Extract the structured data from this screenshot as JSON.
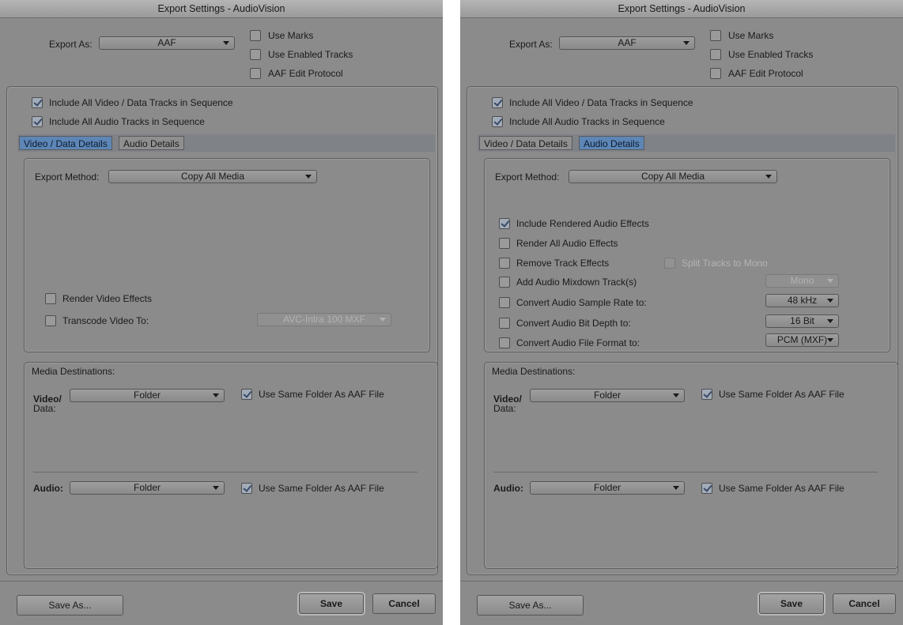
{
  "window_title": "Export Settings - AudioVision",
  "export_as": {
    "label": "Export As:",
    "value": "AAF"
  },
  "options": {
    "use_marks": "Use Marks",
    "use_enabled_tracks": "Use Enabled Tracks",
    "aaf_edit_protocol": "AAF Edit Protocol"
  },
  "include": {
    "video_data": "Include All Video / Data Tracks in Sequence",
    "audio": "Include All Audio Tracks in Sequence"
  },
  "tabs": {
    "video": "Video / Data Details",
    "audio": "Audio Details"
  },
  "export_method": {
    "label": "Export Method:",
    "value": "Copy All Media"
  },
  "video_details": {
    "render_video_effects": "Render Video Effects",
    "transcode_video_to": "Transcode Video To:",
    "transcode_value": "AVC-Intra 100  MXF"
  },
  "audio_details": {
    "include_rendered": "Include Rendered Audio Effects",
    "render_all": "Render All Audio Effects",
    "remove_track_effects": "Remove Track Effects",
    "split_tracks": "Split Tracks to Mono",
    "add_mixdown": "Add Audio Mixdown Track(s)",
    "mixdown_value": "Mono",
    "convert_sample_rate": "Convert Audio Sample Rate to:",
    "sample_rate_value": "48 kHz",
    "convert_bit_depth": "Convert Audio Bit Depth to:",
    "bit_depth_value": "16 Bit",
    "convert_file_format": "Convert Audio File Format to:",
    "file_format_value": "PCM  (MXF)"
  },
  "media_destinations": {
    "label": "Media Destinations:",
    "video_label_1": "Video/",
    "video_label_2": "Data:",
    "video_value": "Folder",
    "audio_label": "Audio:",
    "audio_value": "Folder",
    "same_folder": "Use Same Folder As AAF File"
  },
  "buttons": {
    "save_as": "Save As...",
    "save": "Save",
    "cancel": "Cancel"
  }
}
